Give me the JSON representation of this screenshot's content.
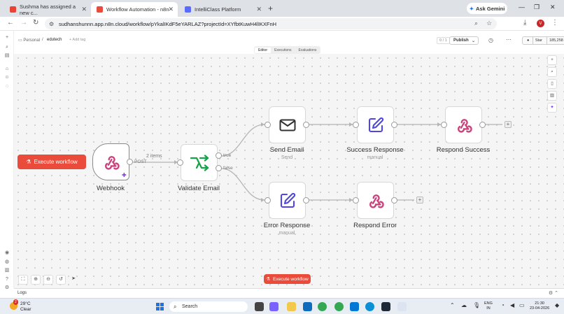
{
  "browser": {
    "tabs": [
      {
        "title": "Sushma has assigned a new c...",
        "favicon": "gmail-icon",
        "active": false
      },
      {
        "title": "Workflow Automation - n8n",
        "favicon": "n8n-icon",
        "active": true
      },
      {
        "title": "IntelliClass Platform",
        "favicon": "site-icon",
        "active": false
      }
    ],
    "new_tab": "+",
    "ask_gemini": "Ask Gemini",
    "url": "sudhanshunnn.app.n8n.cloud/workflow/pYkalIKdF5eYARLAZ?projectId=XYfbtKuwH4lIKXFnH",
    "profile_initial": "V"
  },
  "header": {
    "crumb_project": "Personal",
    "crumb_sep": "/",
    "crumb_workflow": "edutech",
    "add_tag": "+ Add tag",
    "version_counter": "0 / 1",
    "publish_label": "Publish",
    "github_star": "Star",
    "github_count": "185,258"
  },
  "modes": [
    "Editor",
    "Executions",
    "Evaluations"
  ],
  "canvas": {
    "execute_label": "Execute workflow",
    "nodes": {
      "webhook": {
        "name": "Webhook"
      },
      "validate": {
        "name": "Validate Email"
      },
      "send_email": {
        "name": "Send Email",
        "sub": "Send"
      },
      "success_response": {
        "name": "Success Response",
        "sub": "manual"
      },
      "respond_success": {
        "name": "Respond Success"
      },
      "error_response": {
        "name": "Error Response",
        "sub": "manual"
      },
      "respond_error": {
        "name": "Respond Error"
      }
    },
    "edge_labels": {
      "items": "2 items",
      "method": "POST",
      "true": "true",
      "false": "false"
    }
  },
  "logs": {
    "label": "Logs"
  },
  "taskbar": {
    "temperature": "29°C",
    "condition": "Clear",
    "weather_badge": "2",
    "search_label": "Search",
    "lang_top": "ENG",
    "lang_bottom": "IN",
    "time": "21:30",
    "date": "23-04-2026"
  },
  "colors": {
    "accent": "#ea4b3b",
    "webhook": "#c9427b",
    "validate": "#16a34a",
    "edit": "#4f46e5"
  }
}
